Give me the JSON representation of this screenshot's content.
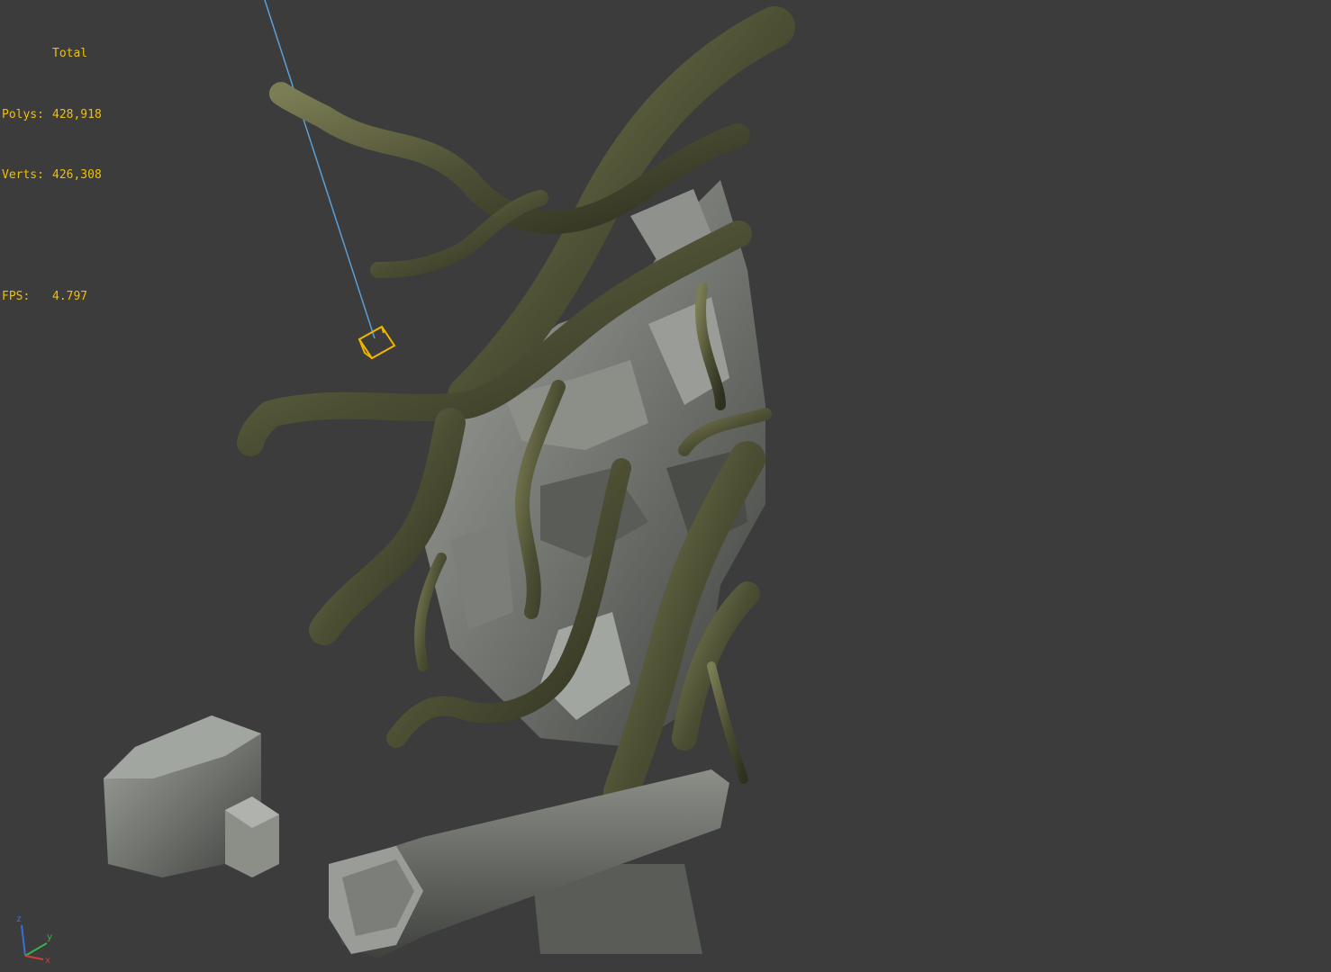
{
  "viewport": {
    "name": "3d-perspective-viewport",
    "background": "#3c3c3c",
    "stats": {
      "header": "Total",
      "polys_label": "Polys:",
      "polys_value": "428,918",
      "verts_label": "Verts:",
      "verts_value": "426,308",
      "fps_label": "FPS:",
      "fps_value": "4.797",
      "color": "#f0c000"
    },
    "axis_gizmo": {
      "x": "x",
      "y": "y",
      "z": "z"
    },
    "colors": {
      "root": "#4d4f34",
      "root_highlight": "#7b7d55",
      "rock": "#6e716c",
      "rock_light": "#a2a6a0",
      "rock_dark": "#3f413e",
      "light_line": "#5b9fd6",
      "light_box": "#f0b400"
    }
  }
}
